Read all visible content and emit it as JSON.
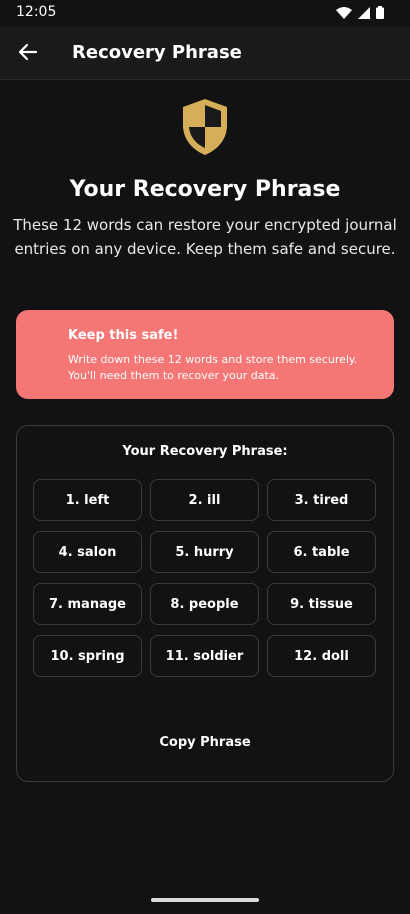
{
  "status_bar": {
    "time": "12:05",
    "icons": [
      "wifi-icon",
      "signal-icon",
      "battery-icon"
    ]
  },
  "app_bar": {
    "title": "Recovery Phrase",
    "back_icon": "arrow-left-icon"
  },
  "hero": {
    "icon": "shield-icon",
    "title": "Your Recovery Phrase",
    "description": "These 12 words can restore your encrypted journal entries on any device. Keep them safe and secure."
  },
  "warning": {
    "title": "Keep this safe!",
    "text": "Write down these 12 words and store them securely. You'll need them to recover your data."
  },
  "phrase": {
    "heading": "Your Recovery Phrase:",
    "words": [
      "1. left",
      "2. ill",
      "3. tired",
      "4. salon",
      "5. hurry",
      "6. table",
      "7. manage",
      "8. people",
      "9. tissue",
      "10. spring",
      "11. soldier",
      "12. doll"
    ],
    "copy_label": "Copy Phrase"
  },
  "colors": {
    "background": "#121212",
    "warning": "#f47675",
    "shield_gold": "#d6ad58",
    "shield_dark": "#1a1a1a"
  }
}
